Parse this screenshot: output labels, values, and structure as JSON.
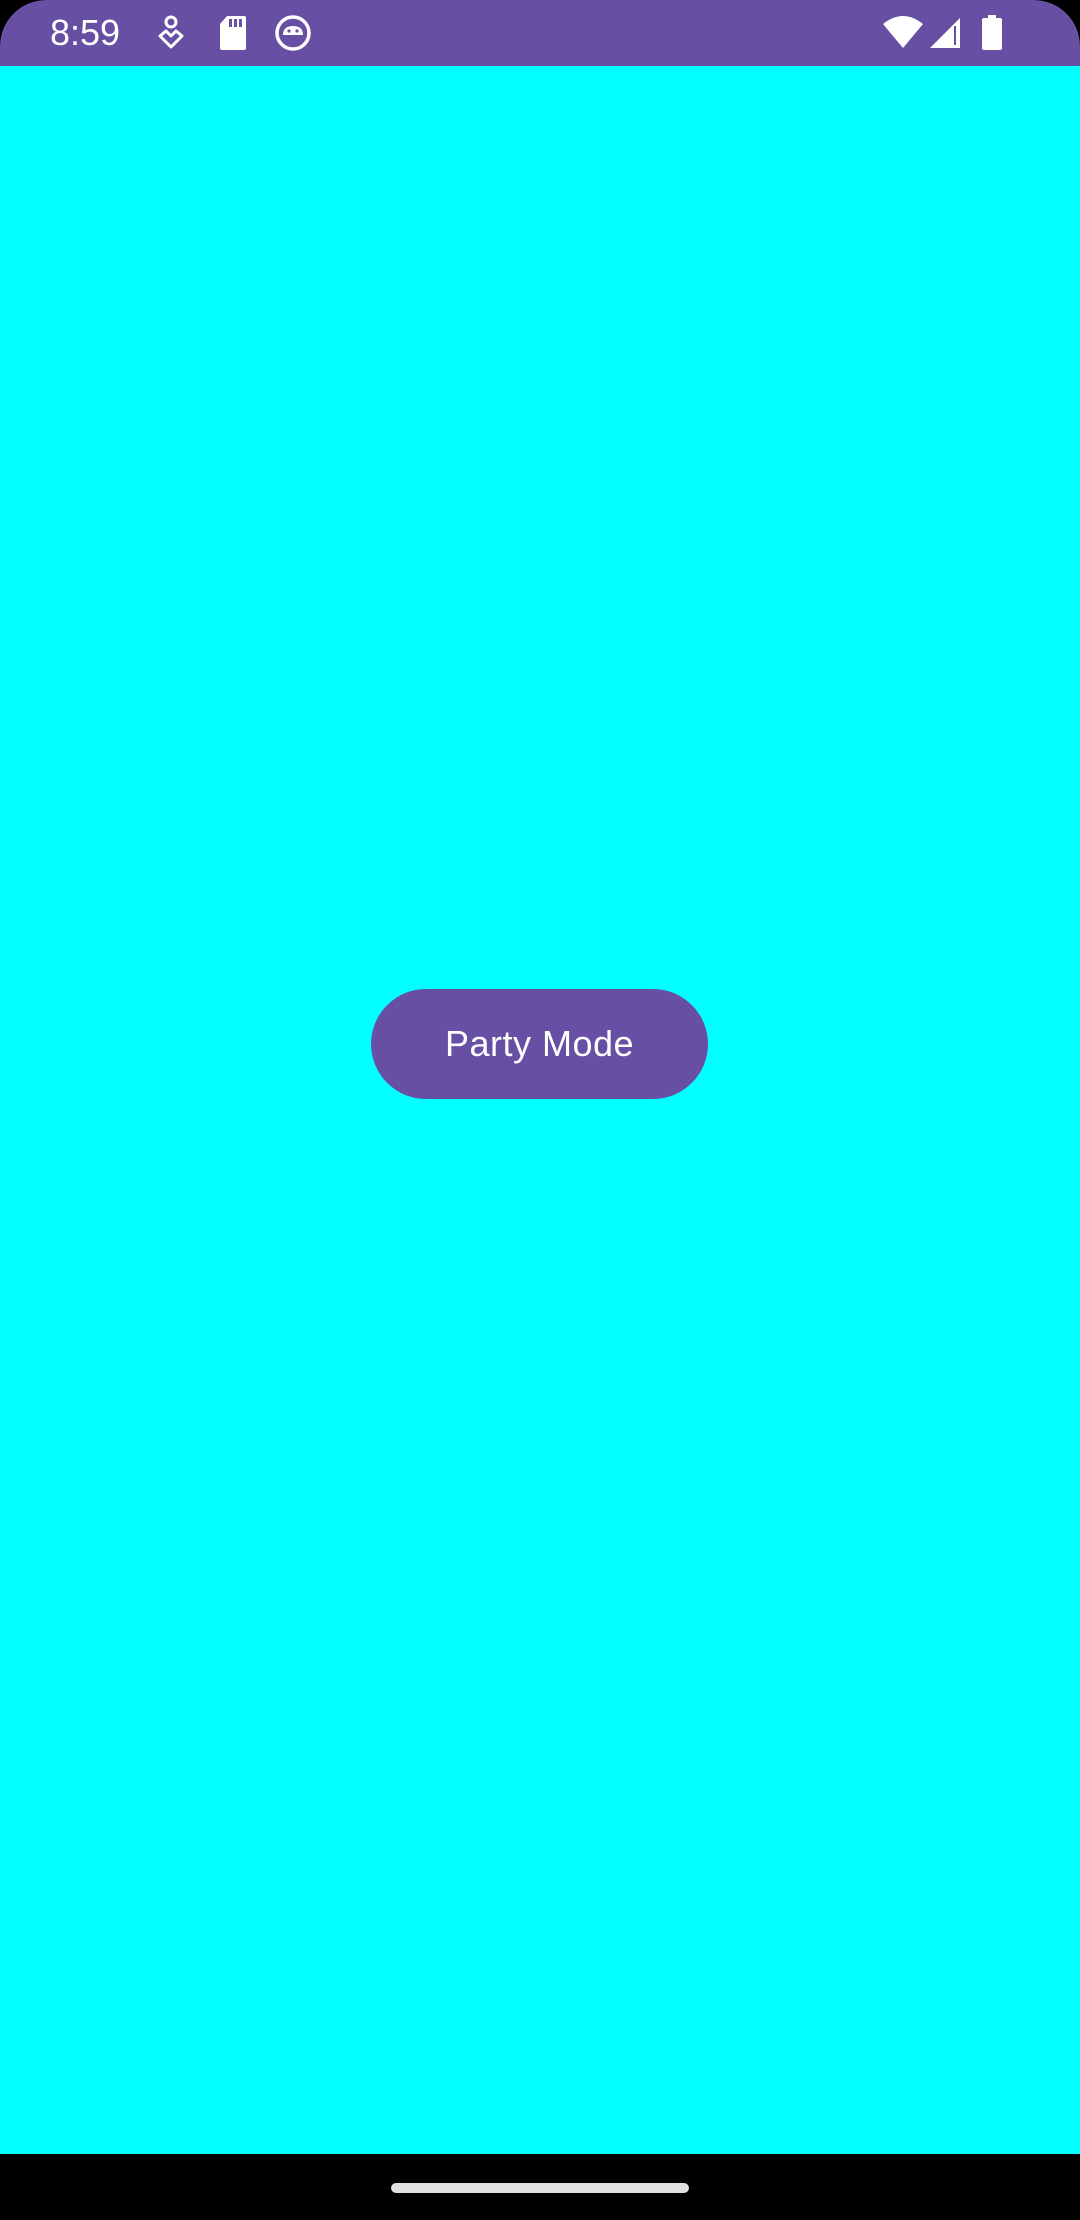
{
  "status_bar": {
    "time": "8:59",
    "background_color": "#6750a4",
    "left_icons": [
      "accessibility-icon",
      "sd-card-icon",
      "android-debug-icon"
    ],
    "right_icons": [
      "wifi-icon",
      "cellular-signal-icon",
      "battery-icon"
    ]
  },
  "main": {
    "background_color": "#00ffff",
    "party_button_label": "Party Mode",
    "button_color": "#6750a4"
  },
  "nav_bar": {
    "background_color": "#000000",
    "handle_color": "#e0e0e0"
  }
}
